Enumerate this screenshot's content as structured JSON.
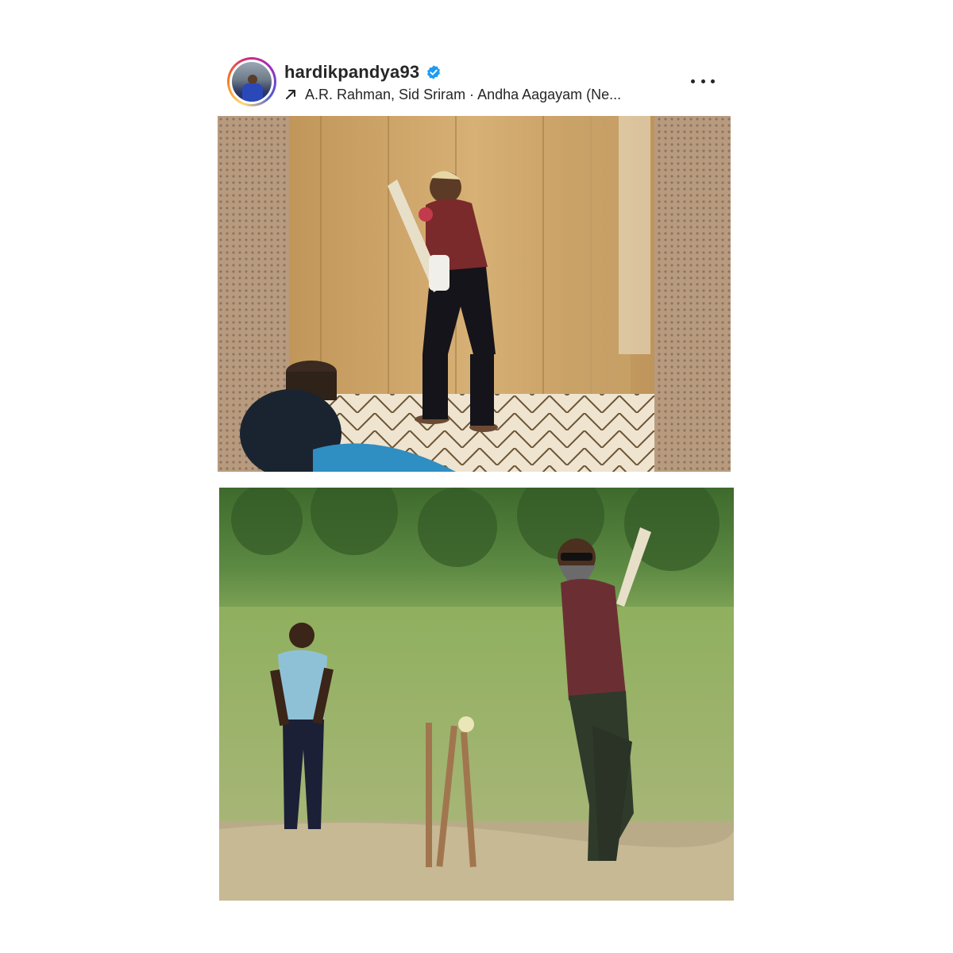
{
  "post": {
    "username": "hardikpandya93",
    "audio": "A.R. Rahman, Sid Sriram · Andha Aagayam (Ne...",
    "icons": {
      "verified": "verified-badge-icon",
      "audio": "arrow-up-right-icon",
      "more": "more-options-icon"
    }
  },
  "colors": {
    "verified_blue": "#1d9bf0",
    "text": "#262626",
    "ring_start": "#feda75",
    "ring_mid": "#d62976",
    "ring_end": "#4f5bd5"
  }
}
